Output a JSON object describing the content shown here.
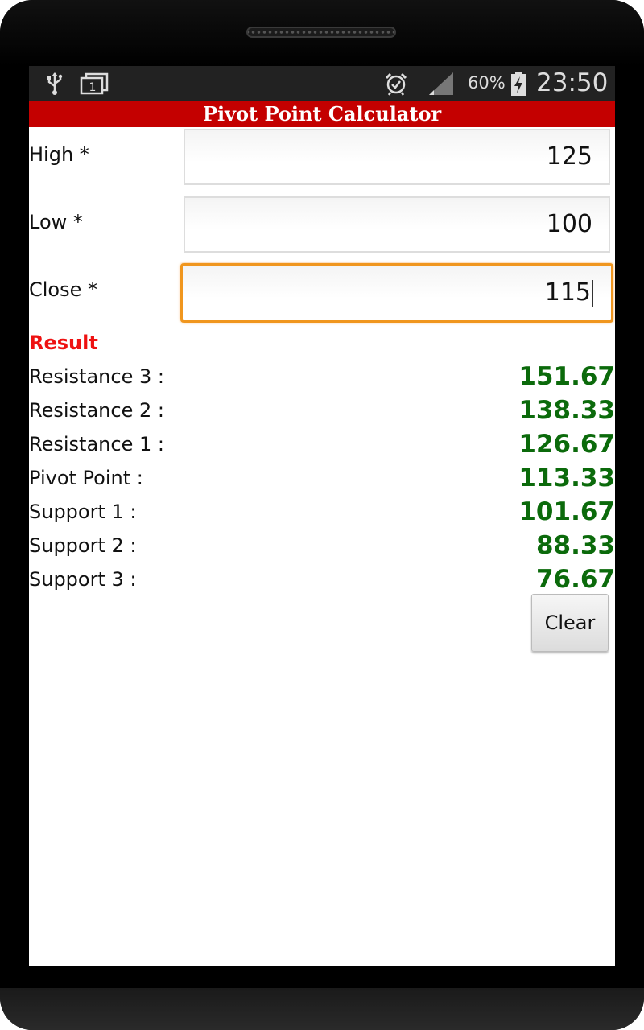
{
  "status_bar": {
    "battery": "60%",
    "time": "23:50",
    "notification_count": "1",
    "icons": [
      "usb-icon",
      "notification-screenshot-icon",
      "alarm-icon",
      "signal-icon",
      "battery-charging-icon"
    ]
  },
  "app": {
    "title": "Pivot Point Calculator"
  },
  "fields": [
    {
      "label": "High *",
      "value": "125"
    },
    {
      "label": "Low *",
      "value": "100"
    },
    {
      "label": "Close *",
      "value": "115"
    }
  ],
  "result": {
    "heading": "Result",
    "rows": [
      {
        "label": "Resistance 3 :",
        "value": "151.67"
      },
      {
        "label": "Resistance 2 :",
        "value": "138.33"
      },
      {
        "label": "Resistance 1 :",
        "value": "126.67"
      },
      {
        "label": "Pivot Point :",
        "value": "113.33"
      },
      {
        "label": "Support 1 :",
        "value": "101.67"
      },
      {
        "label": "Support 2 :",
        "value": "88.33"
      },
      {
        "label": "Support 3 :",
        "value": "76.67"
      }
    ]
  },
  "actions": {
    "clear_label": "Clear"
  },
  "colors": {
    "title_bar": "#c40000",
    "result_heading": "#ee1111",
    "result_value": "#0b6a0b",
    "focus_border": "#f0961e"
  }
}
